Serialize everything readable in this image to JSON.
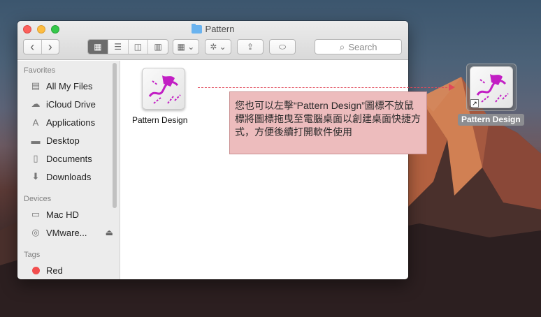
{
  "window": {
    "title": "Pattern"
  },
  "toolbar": {
    "view_icon_glyph": "▦",
    "view_list_glyph": "☰",
    "view_column_glyph": "◫",
    "view_cover_glyph": "▥",
    "arrange_glyph": "▦ ⌄",
    "action_glyph": "✲ ⌄",
    "share_glyph": "⇪",
    "tag_glyph": "⬭",
    "back_glyph": "‹",
    "forward_glyph": "›",
    "search_placeholder": "Search",
    "search_glyph": "⌕"
  },
  "sidebar": {
    "favorites_heading": "Favorites",
    "favorites": [
      {
        "label": "All My Files",
        "icon": "all-files-icon",
        "glyph": "▤"
      },
      {
        "label": "iCloud Drive",
        "icon": "cloud-icon",
        "glyph": "☁"
      },
      {
        "label": "Applications",
        "icon": "applications-icon",
        "glyph": "A"
      },
      {
        "label": "Desktop",
        "icon": "desktop-icon",
        "glyph": "▬"
      },
      {
        "label": "Documents",
        "icon": "documents-icon",
        "glyph": "▯"
      },
      {
        "label": "Downloads",
        "icon": "downloads-icon",
        "glyph": "⬇"
      }
    ],
    "devices_heading": "Devices",
    "devices": [
      {
        "label": "Mac HD",
        "icon": "hard-drive-icon",
        "glyph": "▭"
      },
      {
        "label": "VMware...",
        "icon": "disc-icon",
        "glyph": "◎",
        "eject_glyph": "⏏"
      }
    ],
    "tags_heading": "Tags",
    "tags": [
      {
        "label": "Red",
        "color": "#f24e4e"
      }
    ]
  },
  "content": {
    "files": [
      {
        "name": "Pattern Design"
      }
    ]
  },
  "callout": {
    "text": "您也可以左擊“Pattern Design”圖標不放鼠標將圖標拖曳至電腦桌面以創建桌面快捷方式，方便後續打開軟件使用"
  },
  "desktop": {
    "icon_label": "Pattern Design",
    "alias_glyph": "↗"
  },
  "colors": {
    "accent_magenta": "#c21ec4",
    "callout_bg": "#edbcbd",
    "arrow": "#e0495a"
  }
}
